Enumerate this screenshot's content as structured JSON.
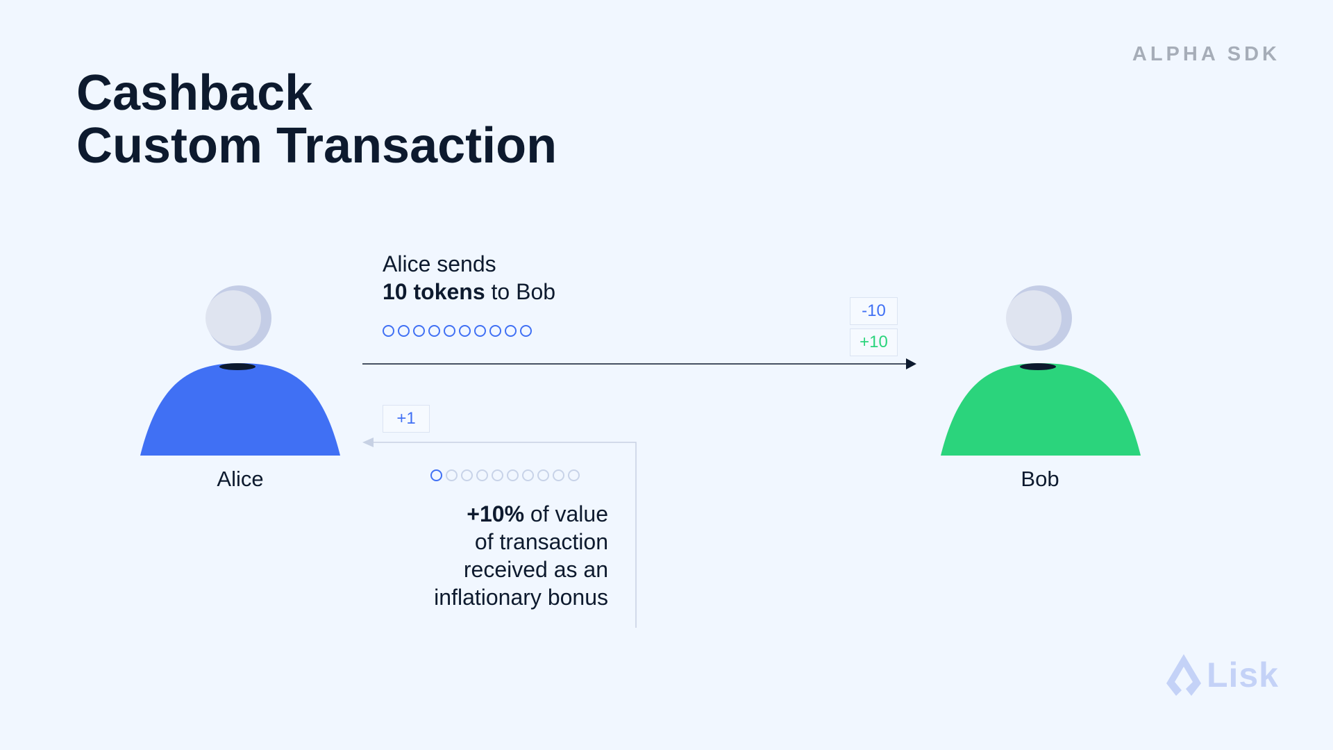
{
  "header": {
    "badge": "ALPHA SDK",
    "title_line1": "Cashback",
    "title_line2": "Custom Transaction"
  },
  "alice": {
    "name": "Alice",
    "color": "#4070f4"
  },
  "bob": {
    "name": "Bob",
    "color": "#2bd47c"
  },
  "send": {
    "line1": "Alice sends",
    "amount_bold": "10 tokens",
    "amount_rest": " to Bob",
    "coin_count": 10,
    "sender_delta": "-10",
    "receiver_delta": "+10"
  },
  "bonus": {
    "delta": "+1",
    "coin_count": 10,
    "coins_filled": 1,
    "percent_bold": "+10%",
    "line1_rest": " of value",
    "line2": "of transaction",
    "line3": "received as an",
    "line4": "inflationary bonus"
  },
  "logo": {
    "text": "Lisk"
  }
}
